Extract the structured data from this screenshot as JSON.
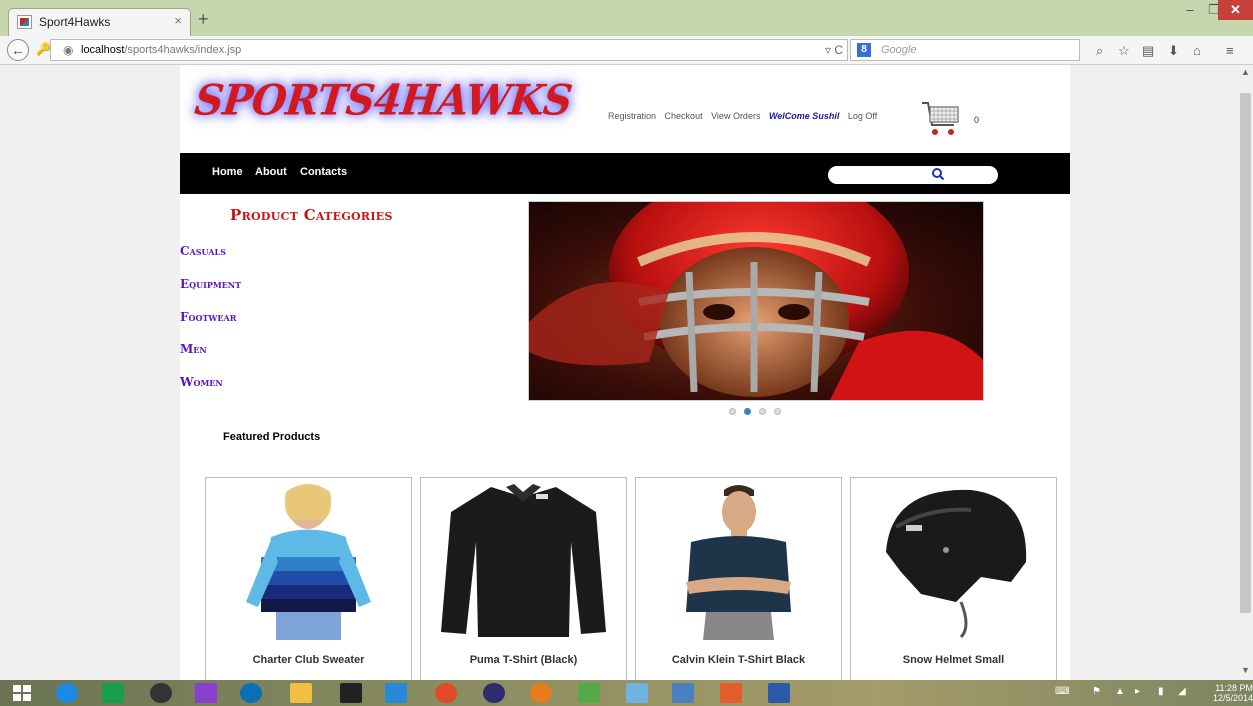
{
  "browser": {
    "tab_title": "Sport4Hawks",
    "tab_close": "×",
    "new_tab": "+",
    "url_host": "localhost",
    "url_path": "/sports4hawks/index.jsp",
    "search_placeholder": "Google",
    "search_engine_glyph": "8"
  },
  "site": {
    "logo_text": "SPORTS4HAWKS",
    "top_links": {
      "registration": "Registration",
      "checkout": "Checkout",
      "view_orders": "View Orders",
      "welcome": "WelCome Sushil",
      "logoff": "Log Off"
    },
    "cart_count": "0",
    "nav": {
      "home": "Home",
      "about": "About",
      "contacts": "Contacts"
    },
    "categories_title": "Product Categories",
    "categories": [
      "Casuals",
      "Equipment",
      "Footwear",
      "Men",
      "Women"
    ],
    "carousel": {
      "slides": 4,
      "active": 2
    },
    "featured_title": "Featured Products",
    "products": [
      {
        "name": "Charter Club Sweater"
      },
      {
        "name": "Puma T-Shirt (Black)"
      },
      {
        "name": "Calvin Klein T-Shirt Black"
      },
      {
        "name": "Snow Helmet Small"
      }
    ]
  },
  "taskbar": {
    "time": "11:28 PM",
    "date": "12/5/2014"
  },
  "colors": {
    "accent_nav": "#000000",
    "category_color": "#5a13c0",
    "category_title_color": "#c81414",
    "welcome_color": "#1a1aa8",
    "active_dot": "#2f86c8"
  }
}
